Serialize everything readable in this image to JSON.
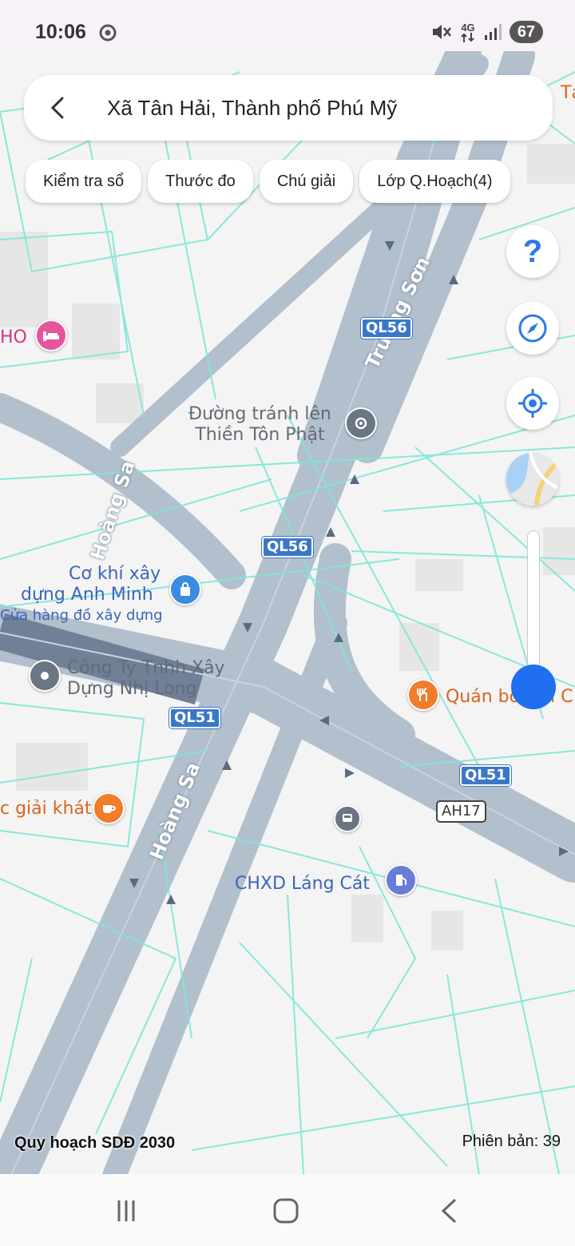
{
  "status_bar": {
    "time": "10:06",
    "network": "4G",
    "battery": "67"
  },
  "search_bar": {
    "title": "Xã Tân Hải, Thành phố Phú Mỹ"
  },
  "chips": [
    {
      "label": "Kiểm tra sổ"
    },
    {
      "label": "Thước đo"
    },
    {
      "label": "Chú giải"
    },
    {
      "label": "Lớp Q.Hoạch(4)"
    }
  ],
  "controls": {
    "help_symbol": "?"
  },
  "map": {
    "places": {
      "duong_tranh_line1": "Đường tránh lên",
      "duong_tranh_line2": "Thiền Tôn Phật",
      "co_khi_line1": "Cơ khí xây",
      "co_khi_line2": "dựng Anh Minh",
      "co_khi_category": "Cửa hàng đồ xây dựng",
      "cong_ty_line1": "Công Ty Tnhh Xây",
      "cong_ty_line2": "Dựng Nhị Long",
      "quan": "Quán bò Dũi C",
      "giai_khat": "c giải khát",
      "chxd": "CHXD Láng Cát",
      "hotel_fragment": "HO",
      "top_right_fragment": "Tạ"
    },
    "roads": {
      "truong_son": "Trường Sơn",
      "hoang_sa": "Hoàng Sa"
    },
    "shields": {
      "ql56_a": "QL56",
      "ql56_b": "QL56",
      "ql51_a": "QL51",
      "ql51_b": "QL51",
      "ah17": "AH17"
    },
    "colors": {
      "road": "#aebccb",
      "parcel_lines": "#7ee6d8",
      "accent": "#1f6ff0"
    }
  },
  "footer": {
    "plan_label": "Quy hoạch SDĐ 2030",
    "version_label": "Phiên bản: 39"
  }
}
